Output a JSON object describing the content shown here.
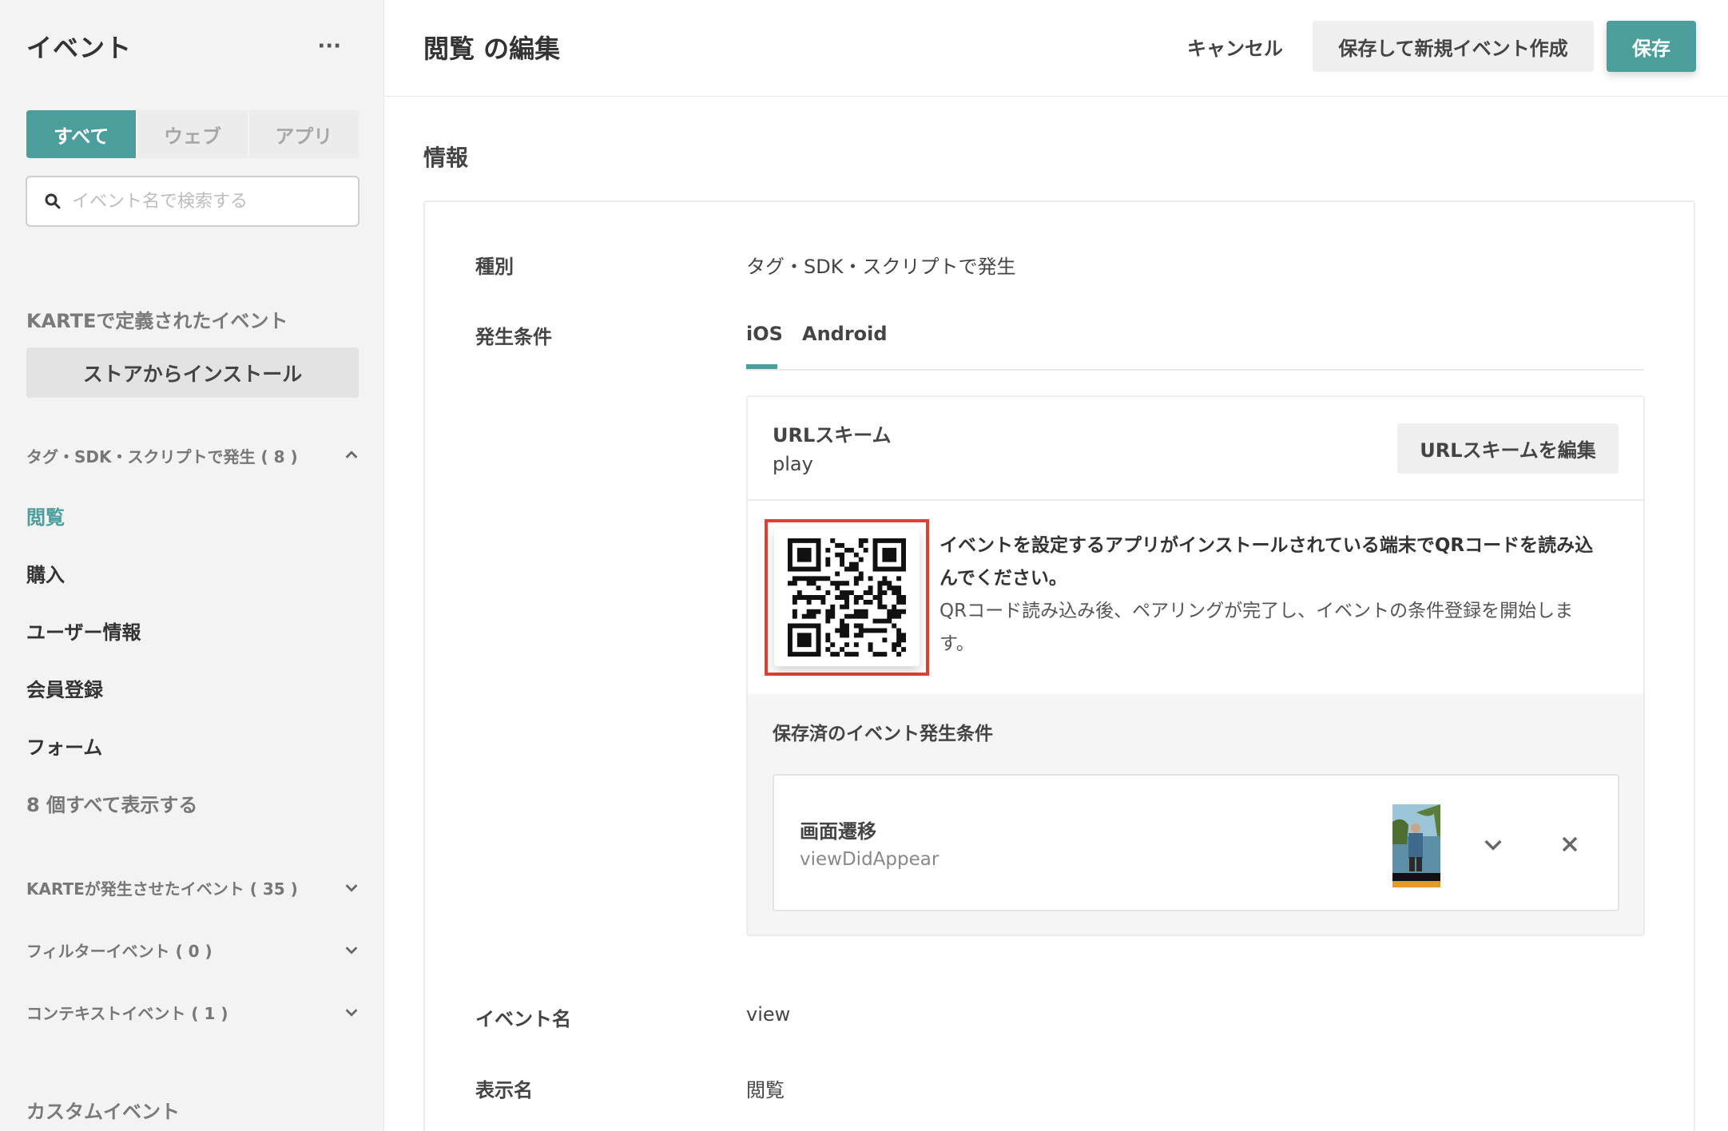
{
  "sidebar": {
    "title": "イベント",
    "more": "···",
    "filters": [
      "すべて",
      "ウェブ",
      "アプリ"
    ],
    "active_filter": 0,
    "search_placeholder": "イベント名で検索する",
    "karte_defined_label": "KARTEで定義されたイベント",
    "store_button": "ストアからインストール",
    "groups": [
      {
        "label": "タグ・SDK・スクリプトで発生 ( 8 )",
        "expanded": true
      },
      {
        "label": "KARTEが発生させたイベント ( 35 )",
        "expanded": false
      },
      {
        "label": "フィルターイベント ( 0 )",
        "expanded": false
      },
      {
        "label": "コンテキストイベント ( 1 )",
        "expanded": false
      }
    ],
    "items": [
      "閲覧",
      "購入",
      "ユーザー情報",
      "会員登録",
      "フォーム"
    ],
    "active_item": 0,
    "show_all": "8 個すべて表示する",
    "custom_label": "カスタムイベント"
  },
  "header": {
    "title": "閲覧 の編集",
    "cancel": "キャンセル",
    "save_new": "保存して新規イベント作成",
    "save": "保存"
  },
  "info": {
    "section_title": "情報",
    "type_label": "種別",
    "type_value": "タグ・SDK・スクリプトで発生",
    "condition_label": "発生条件",
    "tabs": [
      "iOS",
      "Android"
    ],
    "active_tab": 0,
    "url_scheme_label": "URLスキーム",
    "url_scheme_value": "play",
    "url_scheme_edit": "URLスキームを編集",
    "qr_main_1": "イベントを設定するアプリがインストールされている端末でQRコードを読み込",
    "qr_main_2": "んでください。",
    "qr_sub_1": "QRコード読み込み後、ペアリングが完了し、イベントの条件登録を開始しま",
    "qr_sub_2": "す。",
    "saved_title": "保存済のイベント発生条件",
    "saved_conditions": [
      {
        "name": "画面遷移",
        "code": "viewDidAppear"
      }
    ],
    "event_name_label": "イベント名",
    "event_name_value": "view",
    "display_name_label": "表示名",
    "display_name_value": "閲覧"
  },
  "colors": {
    "accent": "#4b9e9c",
    "highlight": "#e0402d"
  }
}
